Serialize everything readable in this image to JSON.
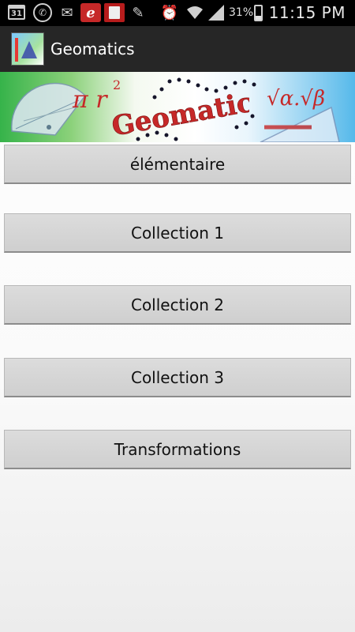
{
  "status_bar": {
    "icons": [
      "calendar-icon",
      "whatsapp-icon",
      "email-icon",
      "e-app-icon",
      "app-notification-icon",
      "pencil-icon",
      "alarm-icon",
      "wifi-icon",
      "signal-icon"
    ],
    "calendar_day": "31",
    "battery_percent_text": "31%",
    "battery_level": 0.31,
    "time": "11:15 PM"
  },
  "action_bar": {
    "app_icon": "geomatics-app-icon",
    "title": "Geomatics"
  },
  "banner": {
    "title": "Geomatics",
    "colors": {
      "title": "#c62828",
      "dots": "#1a1a2e"
    }
  },
  "menu": {
    "items": [
      {
        "label": "élémentaire"
      },
      {
        "label": "Collection 1"
      },
      {
        "label": "Collection 2"
      },
      {
        "label": "Collection 3"
      },
      {
        "label": "Transformations"
      }
    ]
  }
}
